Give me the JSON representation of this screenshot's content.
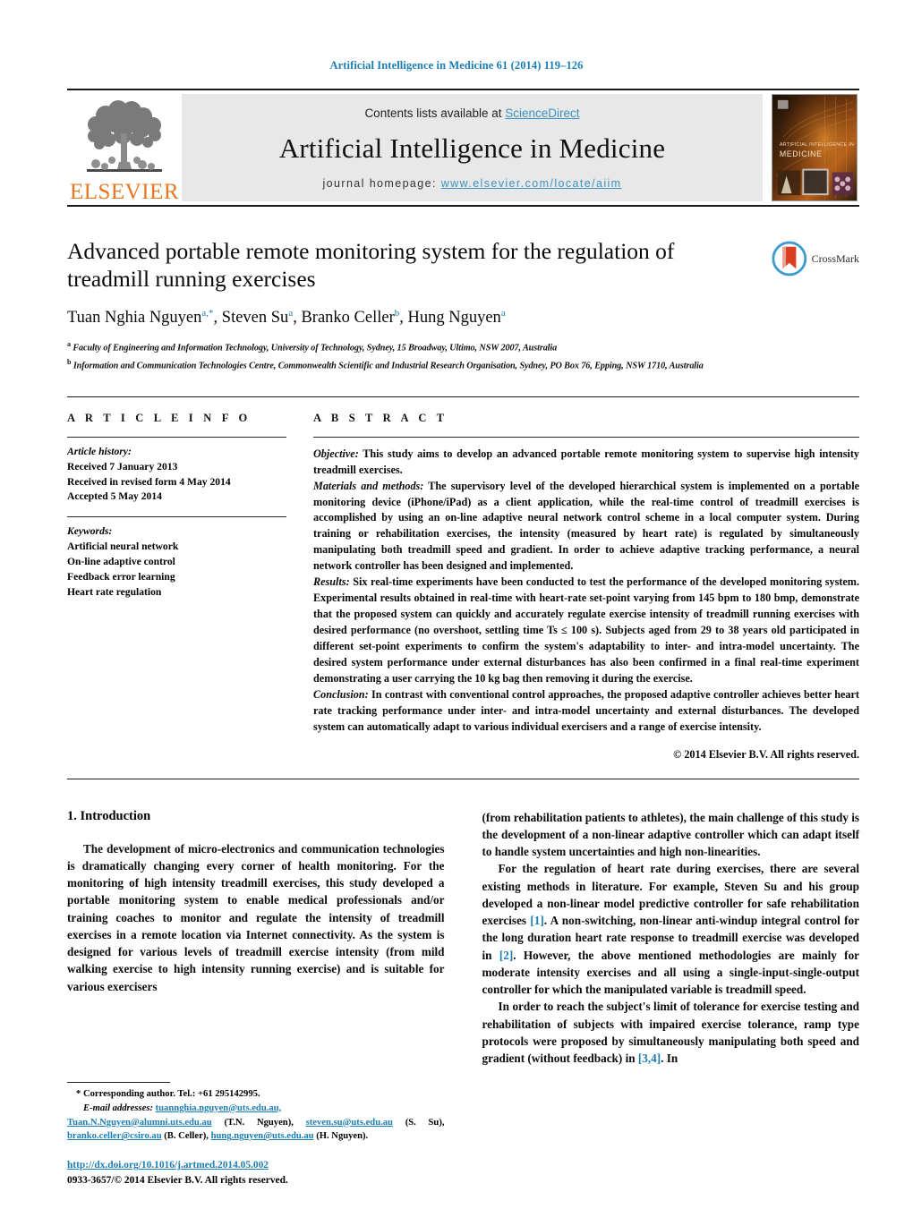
{
  "running_head": "Artificial Intelligence in Medicine 61 (2014) 119–126",
  "masthead": {
    "contents_prefix": "Contents lists available at ",
    "sciencedirect": "ScienceDirect",
    "journal_title": "Artificial Intelligence in Medicine",
    "homepage_prefix": "journal homepage: ",
    "homepage_url": "www.elsevier.com/locate/aiim",
    "publisher": "ELSEVIER",
    "cover_title_line1": "ARTIFICIAL INTELLIGENCE IN",
    "cover_title_line2": "MEDICINE"
  },
  "article": {
    "title": "Advanced portable remote monitoring system for the regulation of treadmill running exercises",
    "authors_html": "Tuan Nghia Nguyen<sup>a,*</sup>, Steven Su<sup>a</sup>, Branko Celler<sup>b</sup>, Hung Nguyen<sup>a</sup>",
    "affiliation_a": "Faculty of Engineering and Information Technology, University of Technology, Sydney, 15 Broadway, Ultimo, NSW 2007, Australia",
    "affiliation_b": "Information and Communication Technologies Centre, Commonwealth Scientific and Industrial Research Organisation, Sydney, PO Box 76, Epping, NSW 1710, Australia",
    "crossmark_label": "CrossMark"
  },
  "article_info": {
    "heading": "A R T I C L E    I N F O",
    "history_label": "Article history:",
    "history": [
      "Received 7 January 2013",
      "Received in revised form 4 May 2014",
      "Accepted 5 May 2014"
    ],
    "keywords_label": "Keywords:",
    "keywords": [
      "Artificial neural network",
      "On-line adaptive control",
      "Feedback error learning",
      "Heart rate regulation"
    ]
  },
  "abstract": {
    "heading": "A B S T R A C T",
    "sections": [
      {
        "label": "Objective:",
        "text": " This study aims to develop an advanced portable remote monitoring system to supervise high intensity treadmill exercises."
      },
      {
        "label": "Materials and methods:",
        "text": " The supervisory level of the developed hierarchical system is implemented on a portable monitoring device (iPhone/iPad) as a client application, while the real-time control of treadmill exercises is accomplished by using an on-line adaptive neural network control scheme in a local computer system. During training or rehabilitation exercises, the intensity (measured by heart rate) is regulated by simultaneously manipulating both treadmill speed and gradient. In order to achieve adaptive tracking performance, a neural network controller has been designed and implemented."
      },
      {
        "label": "Results:",
        "text": " Six real-time experiments have been conducted to test the performance of the developed monitoring system. Experimental results obtained in real-time with heart-rate set-point varying from 145 bpm to 180 bmp, demonstrate that the proposed system can quickly and accurately regulate exercise intensity of treadmill running exercises with desired performance (no overshoot, settling time Ts ≤ 100 s). Subjects aged from 29 to 38 years old participated in different set-point experiments to confirm the system's adaptability to inter- and intra-model uncertainty. The desired system performance under external disturbances has also been confirmed in a final real-time experiment demonstrating a user carrying the 10 kg bag then removing it during the exercise."
      },
      {
        "label": "Conclusion:",
        "text": " In contrast with conventional control approaches, the proposed adaptive controller achieves better heart rate tracking performance under inter- and intra-model uncertainty and external disturbances. The developed system can automatically adapt to various individual exercisers and a range of exercise intensity."
      }
    ],
    "copyright": "© 2014 Elsevier B.V. All rights reserved."
  },
  "body": {
    "section_number_title": "1.  Introduction",
    "left_paragraphs": [
      "The development of micro-electronics and communication technologies is dramatically changing every corner of health monitoring. For the monitoring of high intensity treadmill exercises, this study developed a portable monitoring system to enable medical professionals and/or training coaches to monitor and regulate the intensity of treadmill exercises in a remote location via Internet connectivity. As the system is designed for various levels of treadmill exercise intensity (from mild walking exercise to high intensity running exercise) and is suitable for various exercisers"
    ],
    "right_paragraphs": [
      "(from rehabilitation patients to athletes), the main challenge of this study is the development of a non-linear adaptive controller which can adapt itself to handle system uncertainties and high non-linearities."
    ]
  },
  "footnote": {
    "corresponding": "*  Corresponding author. Tel.: +61 295142995.",
    "email_label": "E-mail addresses:",
    "emails": [
      {
        "addr": "tuannghia.nguyen@uts.edu.au,",
        "who": ""
      },
      {
        "addr": "Tuan.N.Nguyen@alumni.uts.edu.au",
        "who": " (T.N. Nguyen),"
      },
      {
        "addr": "steven.su@uts.edu.au",
        "who": " (S. Su),"
      },
      {
        "addr": "branko.celler@csiro.au",
        "who": " (B. Celler),"
      },
      {
        "addr": "hung.nguyen@uts.edu.au",
        "who": " (H. Nguyen)."
      }
    ],
    "doi": "http://dx.doi.org/10.1016/j.artmed.2014.05.002",
    "issn_line": "0933-3657/© 2014 Elsevier B.V. All rights reserved."
  },
  "colors": {
    "link_blue": "#1a7eb5",
    "sciencedirect_blue": "#3c93c2",
    "elsevier_orange": "#E87722",
    "band_gray": "#e8e8e8"
  }
}
